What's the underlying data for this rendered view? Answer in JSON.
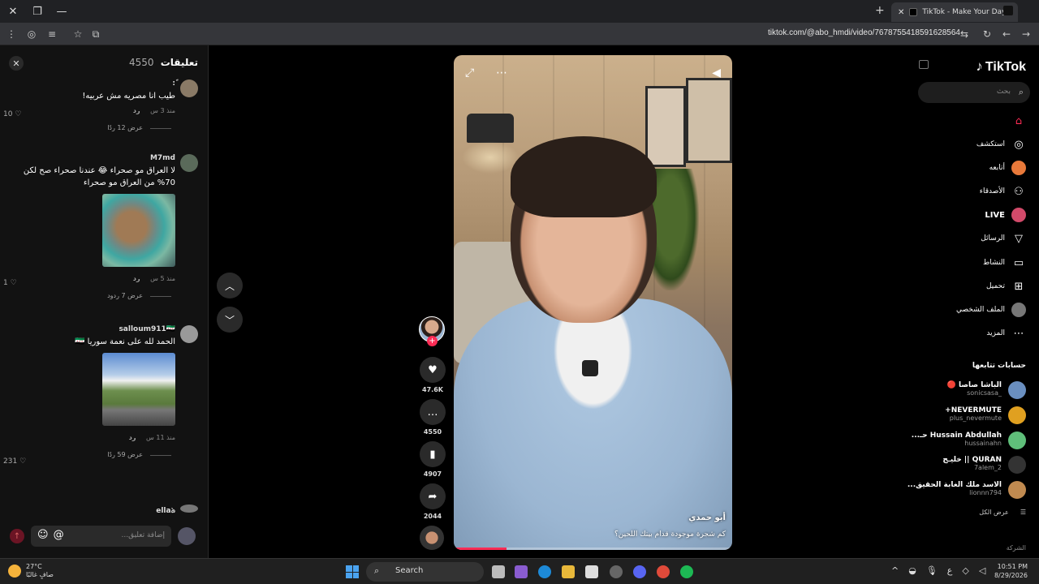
{
  "browser": {
    "tab_title": "TikTok - Make Your Day",
    "address": "tiktok.com/@abo_hmdi/video/7678755418591628564"
  },
  "comments": {
    "title": "تعليقات",
    "count": "4550",
    "items": [
      {
        "user": "ً:",
        "text": "طيب انا مصريه مش عربيه!",
        "time": "منذ 3 س",
        "reply": "رد",
        "likes": "10",
        "view_more": "عرض 12 ردًا"
      },
      {
        "user": "M7md",
        "text": "لا العراق مو صحراء 😂 عندنا صحراء صح لكن 70% من العراق مو صحراء",
        "time": "منذ 5 س",
        "reply": "رد",
        "likes": "1",
        "view_more": "عرض 7 ردود"
      },
      {
        "user": "salloum911🇸🇾",
        "text": "الحمد لله على نعمة سوريا 🇸🇾",
        "time": "منذ 11 س",
        "reply": "رد",
        "likes": "231",
        "view_more": "عرض 59 ردًا"
      },
      {
        "user": "ellaঌ",
        "text": "",
        "time": "",
        "reply": "",
        "likes": "",
        "view_more": ""
      }
    ],
    "input_placeholder": "إضافة تعليق..."
  },
  "video": {
    "author": "أبو حمدي",
    "caption": "كم شجرة موجودة قدام بيتك اللحين؟",
    "progress": 0.19
  },
  "actions": {
    "likes": "47.6K",
    "comments": "4550",
    "saves": "4907",
    "shares": "2044"
  },
  "sidebar": {
    "logo": "TikTok",
    "search_placeholder": "بحث",
    "nav": [
      {
        "label": "",
        "icon": "home-icon"
      },
      {
        "label": "استكشف",
        "icon": "compass-icon"
      },
      {
        "label": "أتابعه",
        "icon": "following-icon"
      },
      {
        "label": "الأصدقاء",
        "icon": "friends-icon"
      },
      {
        "label": "LIVE",
        "icon": "live-icon"
      },
      {
        "label": "الرسائل",
        "icon": "send-icon"
      },
      {
        "label": "النشاط",
        "icon": "activity-icon"
      },
      {
        "label": "تحميل",
        "icon": "upload-icon"
      },
      {
        "label": "الملف الشخصي",
        "icon": "profile-icon"
      },
      {
        "label": "المزيد",
        "icon": "more-icon"
      }
    ],
    "following_title": "حسابات تتابعها",
    "following": [
      {
        "name": "الباشا صاصا 🔴",
        "handle": "_sonicsasa"
      },
      {
        "name": "NEVERMUTE+",
        "handle": "plus_nevermute"
      },
      {
        "name": "Hussain Abdullah حـ...",
        "handle": "hussainahn"
      },
      {
        "name": "QURAN || خليـج",
        "handle": "7alem_2"
      },
      {
        "name": "الاسد ملك الغابة الحقيق...",
        "handle": "lionnn794"
      }
    ],
    "see_all": "عرض الكل",
    "company": "الشركة"
  },
  "taskbar": {
    "temp": "27°C",
    "weather": "صافٍ غالبًا",
    "search": "Search",
    "time": "10:51 PM",
    "date": "8/29/2026"
  }
}
